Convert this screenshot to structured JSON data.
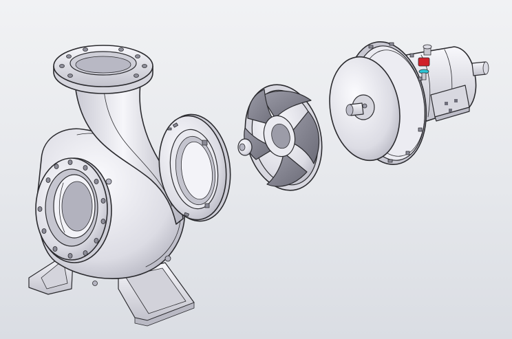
{
  "scene": {
    "background_top": "#f1f2f4",
    "background_bottom": "#dadde3",
    "metal_light": "#f4f4f8",
    "metal_mid": "#d8d8e0",
    "metal_dark": "#a9a9b4",
    "edge_color": "#2a2a2e",
    "accent_red": "#d0202a",
    "accent_cyan": "#2cc6d6"
  },
  "parts": [
    {
      "id": "pump-casing",
      "icon": "volute-casing-icon"
    },
    {
      "id": "casing-cover-ring",
      "icon": "gasket-ring-icon"
    },
    {
      "id": "impeller",
      "icon": "impeller-icon"
    },
    {
      "id": "bearing-frame",
      "icon": "bearing-housing-icon"
    }
  ]
}
